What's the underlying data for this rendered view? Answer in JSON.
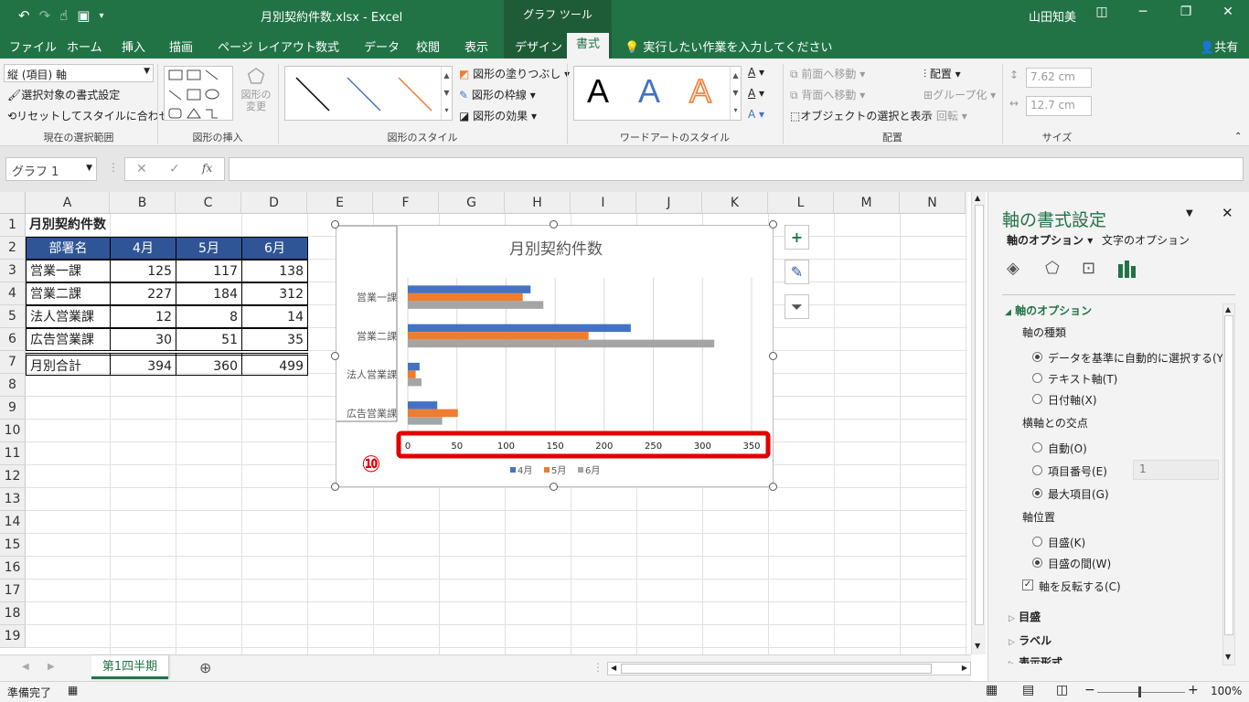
{
  "titlebar": {
    "title": "月別契約件数.xlsx  -  Excel",
    "context_tab_group": "グラフ ツール",
    "user": "山田知美",
    "minimize": "─",
    "restore": "❐",
    "close": "✕",
    "ribbon_display": "◫"
  },
  "tabs": [
    "ファイル",
    "ホーム",
    "挿入",
    "描画",
    "ページ レイアウト",
    "数式",
    "データ",
    "校閲",
    "表示",
    "デザイン",
    "書式"
  ],
  "tell_me": "実行したい作業を入力してください",
  "share": "共有",
  "ribbon": {
    "selection": {
      "combo": "縦 (項目) 軸",
      "format_selection": "選択対象の書式設定",
      "reset_style": "リセットしてスタイルに合わせる",
      "label": "現在の選択範囲"
    },
    "insert_shapes": {
      "change_shape": "図形の変更",
      "label": "図形の挿入"
    },
    "shape_styles": {
      "fill": "図形の塗りつぶし",
      "outline": "図形の枠線",
      "effects": "図形の効果",
      "label": "図形のスタイル",
      "color1": "#000000",
      "color2": "#4472c4",
      "color3": "#ed7d31"
    },
    "wordart": {
      "label": "ワードアートのスタイル",
      "letters": [
        "A",
        "A",
        "A"
      ]
    },
    "arrange": {
      "forward": "前面へ移動",
      "backward": "背面へ移動",
      "selection_pane": "オブジェクトの選択と表示",
      "align": "配置",
      "group": "グループ化",
      "rotate": "回転",
      "label": "配置"
    },
    "size": {
      "height": "7.62 cm",
      "width": "12.7 cm",
      "label": "サイズ"
    }
  },
  "formula_bar": {
    "name_box": "グラフ 1",
    "fx": "fx",
    "cancel": "✕",
    "enter": "✓",
    "value": ""
  },
  "columns": [
    "A",
    "B",
    "C",
    "D",
    "E",
    "F",
    "G",
    "H",
    "I",
    "J",
    "K",
    "L",
    "M",
    "N"
  ],
  "rows": [
    "1",
    "2",
    "3",
    "4",
    "5",
    "6",
    "7",
    "8",
    "9",
    "10",
    "11",
    "12",
    "13",
    "14",
    "15",
    "16",
    "17",
    "18",
    "19"
  ],
  "table": {
    "title": "月別契約件数",
    "headers": [
      "部署名",
      "4月",
      "5月",
      "6月"
    ],
    "data": [
      [
        "営業一課",
        "125",
        "117",
        "138"
      ],
      [
        "営業二課",
        "227",
        "184",
        "312"
      ],
      [
        "法人営業課",
        "12",
        "8",
        "14"
      ],
      [
        "広告営業課",
        "30",
        "51",
        "35"
      ]
    ],
    "total": [
      "月別合計",
      "394",
      "360",
      "499"
    ]
  },
  "chart_data": {
    "type": "bar",
    "orientation": "horizontal",
    "title": "月別契約件数",
    "categories": [
      "営業一課",
      "営業二課",
      "法人営業課",
      "広告営業課"
    ],
    "series": [
      {
        "name": "4月",
        "values": [
          125,
          227,
          12,
          30
        ],
        "color": "#4472c4"
      },
      {
        "name": "5月",
        "values": [
          117,
          184,
          8,
          51
        ],
        "color": "#ed7d31"
      },
      {
        "name": "6月",
        "values": [
          138,
          312,
          14,
          35
        ],
        "color": "#a5a5a5"
      }
    ],
    "xlim": [
      0,
      350
    ],
    "xticks": [
      "0",
      "50",
      "100",
      "150",
      "200",
      "250",
      "300",
      "350"
    ],
    "grid": true,
    "legend": "bottom",
    "annotation": "⑩",
    "highlight_color": "#e00000"
  },
  "pane": {
    "title": "軸の書式設定",
    "tab_axis": "軸のオプション",
    "tab_text": "文字のオプション",
    "section": "軸のオプション",
    "axis_type_label": "軸の種類",
    "axis_type_options": [
      "データを基準に自動的に選択する(Y)",
      "テキスト軸(T)",
      "日付軸(X)"
    ],
    "crosses_label": "横軸との交点",
    "crosses_options": [
      "自動(O)",
      "項目番号(E)",
      "最大項目(G)"
    ],
    "crosses_value": "1",
    "position_label": "軸位置",
    "position_options": [
      "目盛(K)",
      "目盛の間(W)"
    ],
    "reverse": "軸を反転する(C)",
    "collapsed": [
      "目盛",
      "ラベル",
      "表示形式"
    ]
  },
  "sheet_tab": "第1四半期",
  "status": {
    "ready": "準備完了",
    "zoom": "100%"
  }
}
